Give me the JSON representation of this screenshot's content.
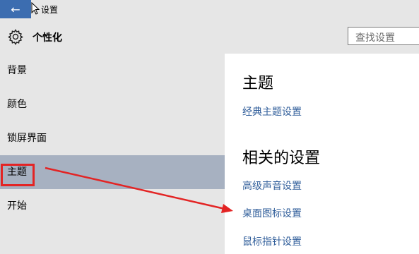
{
  "window": {
    "title": "设置",
    "back_icon": "back-arrow-icon"
  },
  "header": {
    "title": "个性化",
    "icon": "gear-icon",
    "search_placeholder": "查找设置"
  },
  "sidebar": {
    "items": [
      {
        "label": "背景"
      },
      {
        "label": "颜色"
      },
      {
        "label": "锁屏界面"
      },
      {
        "label": "主题"
      },
      {
        "label": "开始"
      }
    ],
    "selected": "主题"
  },
  "main": {
    "section1_title": "主题",
    "section1_links": [
      "经典主题设置"
    ],
    "section2_title": "相关的设置",
    "section2_links": [
      "高级声音设置",
      "桌面图标设置",
      "鼠标指针设置"
    ]
  },
  "colors": {
    "accent": "#3c6db0",
    "sidebar_bg": "#e6e6e6",
    "selected_bg": "#a7b1c1",
    "link": "#325f9b",
    "annotation": "#e32424"
  }
}
